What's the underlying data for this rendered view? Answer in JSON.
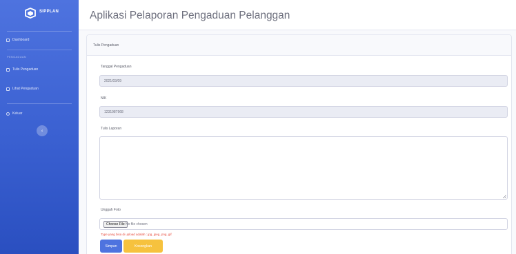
{
  "colors": {
    "sidebar": "#4e73df",
    "primary": "#4e73df",
    "warning": "#f6c23e",
    "danger": "#e74a3b",
    "background": "#f8f9fc"
  },
  "sidebar": {
    "brand_icon": "logo-icon",
    "brand": "SIPPLAN",
    "items": [
      {
        "label": "Dashboard",
        "icon": "dashboard-icon"
      },
      {
        "label": "Tulis Pengaduan",
        "icon": "edit-icon"
      },
      {
        "label": "Lihat Pengaduan",
        "icon": "list-icon"
      },
      {
        "label": "Keluar",
        "icon": "logout-icon"
      }
    ],
    "heading": "Pengaduan",
    "toggle_icon": "chevron-left-icon"
  },
  "header": {
    "title": "Aplikasi Pelaporan Pengaduan Pelanggan"
  },
  "card": {
    "title": "Tulis Pengaduan"
  },
  "form": {
    "date_label": "Tanggal Pengaduan",
    "date_value": "2021/03/09",
    "nik_label": "NIK",
    "nik_value": "1231987968",
    "report_label": "Tulis Laporan",
    "report_value": "",
    "upload_label": "Unggah Foto",
    "choose_file": "Choose File",
    "no_file": "No file chosen",
    "help_text": "Type yang bisa di upload adalah : jpg, jpeg, png, gif",
    "submit": "Simpan",
    "reset": "Kosongkan"
  }
}
